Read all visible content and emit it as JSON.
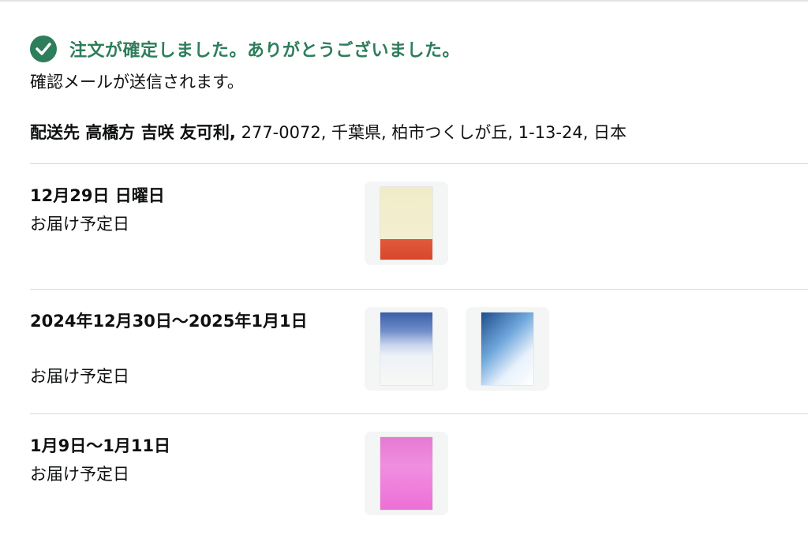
{
  "confirmation": {
    "title": "注文が確定しました。ありがとうございました。",
    "subtitle": "確認メールが送信されます。"
  },
  "address": {
    "prefix": "配送先 高橋方 吉咲 友可利,",
    "detail": " 277-0072, 千葉県, 柏市つくしが丘, 1-13-24, 日本"
  },
  "groups": [
    {
      "date": "12月29日 日曜日",
      "label": "お届け予定日",
      "items": [
        "product-image"
      ]
    },
    {
      "date": "2024年12月30日〜2025年1月1日",
      "label": "お届け予定日",
      "items": [
        "product-image",
        "product-image"
      ]
    },
    {
      "date": "1月9日〜1月11日",
      "label": "お届け予定日",
      "items": [
        "product-image"
      ]
    }
  ],
  "colors": {
    "success": "#2e7d5b",
    "divider": "#d5d9d9",
    "thumb_bg": "#f4f5f5"
  },
  "icons": {
    "confirmation": "check-circle-icon"
  }
}
